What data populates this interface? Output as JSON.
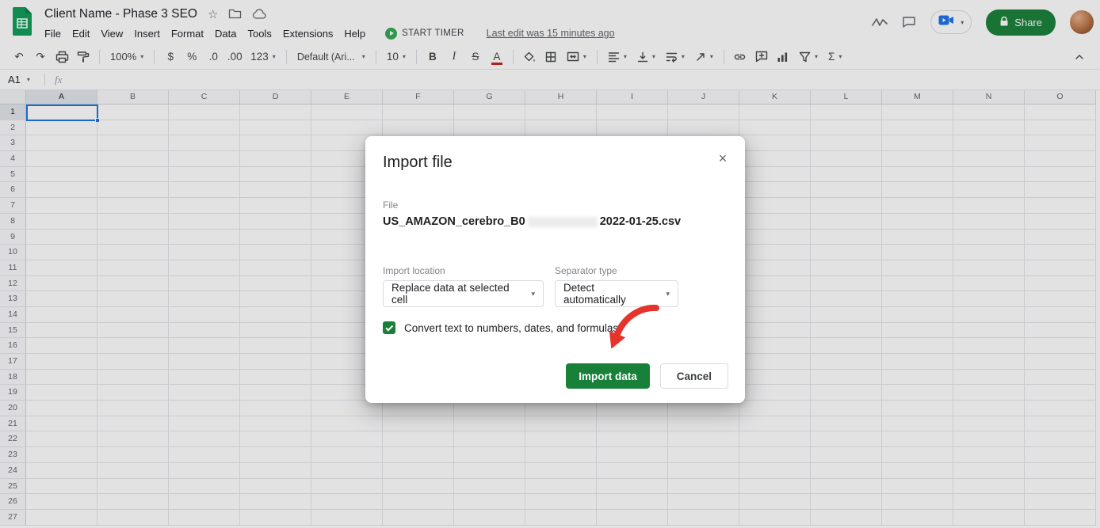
{
  "titlebar": {
    "doc_title": "Client Name - Phase 3 SEO",
    "share_label": "Share"
  },
  "menubar": {
    "menus": [
      "File",
      "Edit",
      "View",
      "Insert",
      "Format",
      "Data",
      "Tools",
      "Extensions",
      "Help"
    ],
    "start_timer_label": "START TIMER",
    "last_edit_label": "Last edit was 15 minutes ago"
  },
  "toolbar": {
    "zoom": "100%",
    "currency": "$",
    "percent": "%",
    "decimal_decrease": ".0",
    "decimal_increase": ".00",
    "more_formats": "123",
    "font_name": "Default (Ari...",
    "font_size": "10",
    "bold": "B",
    "italic": "I",
    "strikethrough": "S",
    "text_color": "A",
    "functions": "Σ"
  },
  "formula_bar": {
    "cell_reference": "A1",
    "fx_label": "fx"
  },
  "grid": {
    "columns": [
      "A",
      "B",
      "C",
      "D",
      "E",
      "F",
      "G",
      "H",
      "I",
      "J",
      "K",
      "L",
      "M",
      "N",
      "O"
    ],
    "row_count": 27,
    "selected_cell": "A1"
  },
  "import_dialog": {
    "title": "Import file",
    "close_label": "×",
    "file_label": "File",
    "file_name_prefix": "US_AMAZON_cerebro_B0",
    "file_name_suffix": "2022-01-25.csv",
    "import_location_label": "Import location",
    "import_location_value": "Replace data at selected cell",
    "separator_type_label": "Separator type",
    "separator_type_value": "Detect automatically",
    "convert_checkbox_label": "Convert text to numbers, dates, and formulas",
    "import_button_label": "Import data",
    "cancel_button_label": "Cancel"
  },
  "colors": {
    "sheets_green": "#0f9d58",
    "button_green": "#188038",
    "selection_blue": "#1a73e8",
    "arrow_red": "#e5342b"
  }
}
